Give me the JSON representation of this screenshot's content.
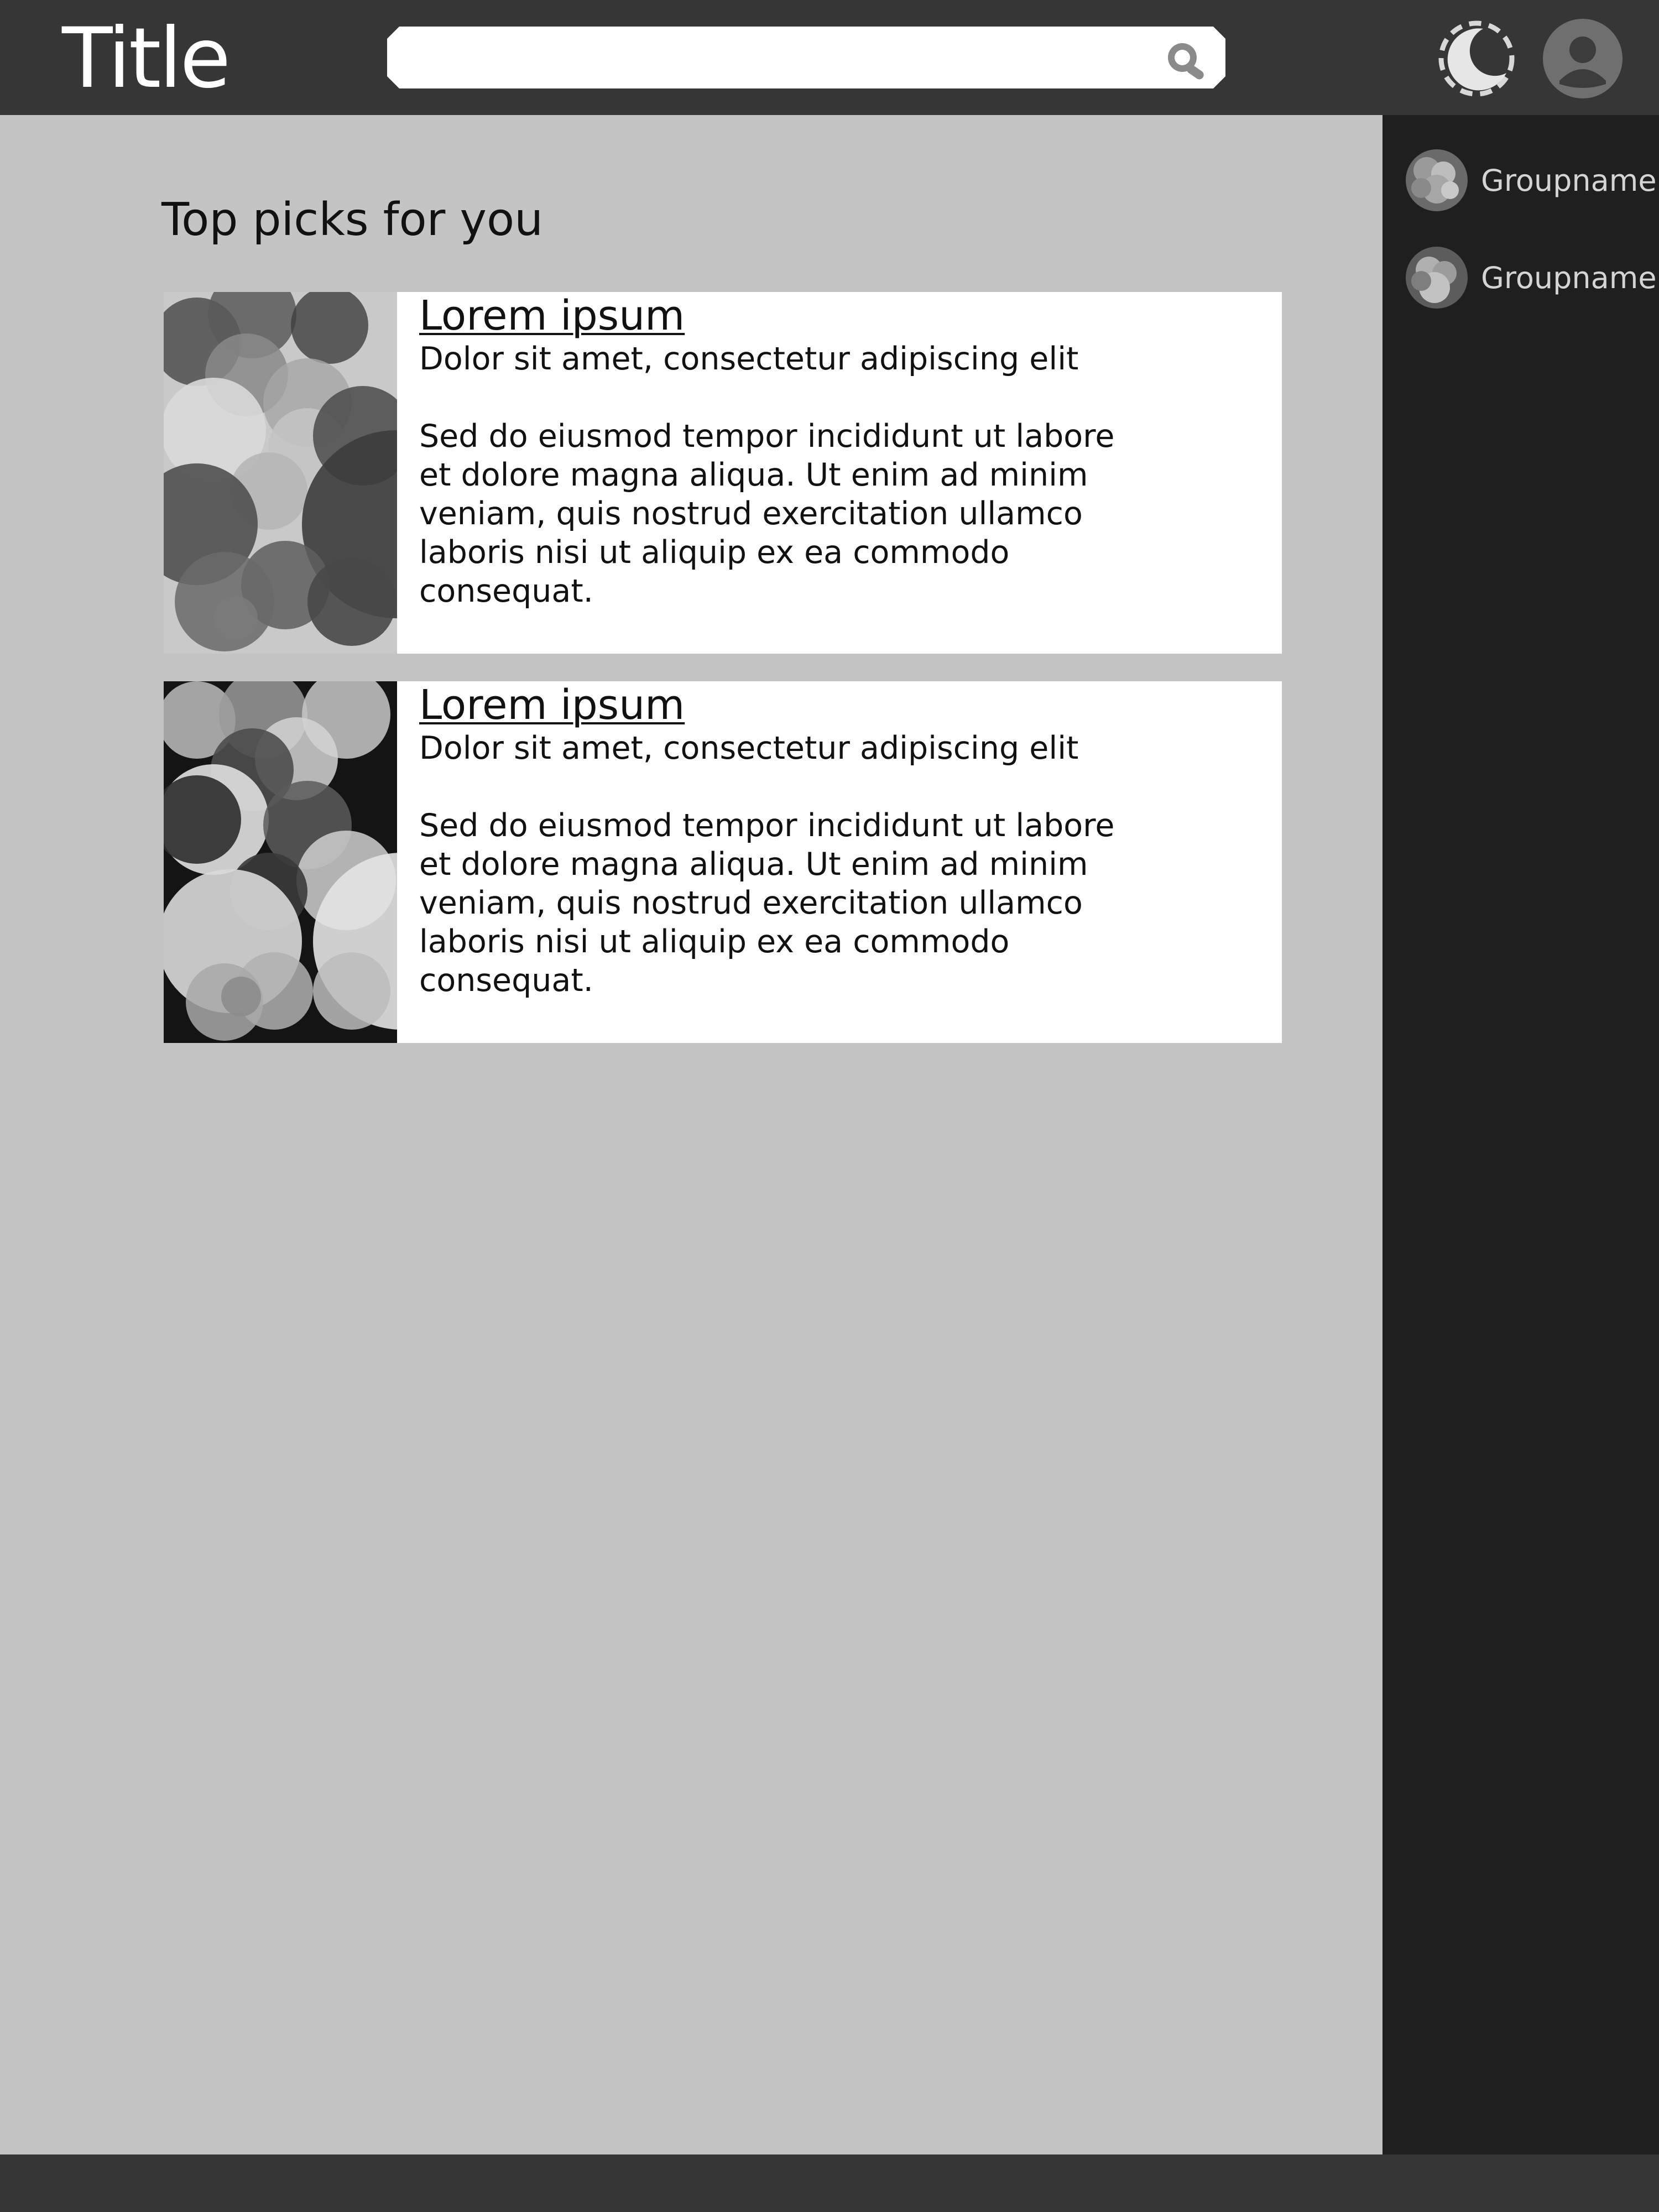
{
  "header": {
    "title": "Title",
    "search": {
      "value": "",
      "placeholder": ""
    },
    "icons": {
      "search": "search-icon",
      "theme": "moon-icon",
      "profile": "user-avatar-icon"
    }
  },
  "main": {
    "section_title": "Top picks for you",
    "cards": [
      {
        "title": "Lorem ipsum",
        "subtitle": "Dolor sit amet, consectetur adipiscing elit",
        "text": "Sed do eiusmod tempor incididunt ut labore et dolore magna aliqua. Ut enim ad minim veniam, quis nostrud exercitation ullamco laboris nisi ut aliquip ex ea commodo consequat."
      },
      {
        "title": "Lorem ipsum",
        "subtitle": "Dolor sit amet, consectetur adipiscing elit",
        "text": "Sed do eiusmod tempor incididunt ut labore et dolore magna aliqua. Ut enim ad minim veniam, quis nostrud exercitation ullamco laboris nisi ut aliquip ex ea commodo consequat."
      }
    ]
  },
  "sidebar": {
    "groups": [
      {
        "label": "Groupname"
      },
      {
        "label": "Groupname"
      }
    ]
  },
  "colors": {
    "header_bg": "#363636",
    "content_bg": "#c4c4c4",
    "sidebar_bg": "#1f1f1f",
    "card_bg": "#ffffff",
    "sidebar_text": "#d4d4d4"
  }
}
